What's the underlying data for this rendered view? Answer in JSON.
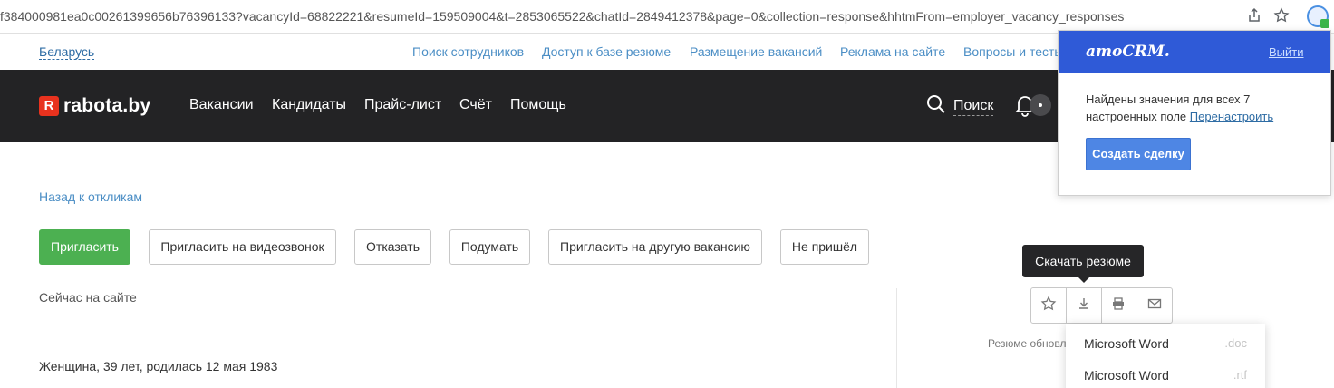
{
  "browser": {
    "url": "f384000981ea0c00261399656b76396133?vacancyId=68822221&resumeId=159509004&t=2853065522&chatId=2849412378&page=0&collection=response&hhtmFrom=employer_vacancy_responses",
    "share_icon": "share-icon",
    "bookmark_icon": "star-icon",
    "extension_icon": "amocrm-extension-icon"
  },
  "toplinks": {
    "region": "Беларусь",
    "items": [
      "Поиск сотрудников",
      "Доступ к базе резюме",
      "Размещение вакансий",
      "Реклама на сайте",
      "Вопросы и тесты"
    ]
  },
  "nav": {
    "logo_letter": "R",
    "logo_text": "rabota.by",
    "items": [
      "Вакансии",
      "Кандидаты",
      "Прайс-лист",
      "Счёт",
      "Помощь"
    ],
    "search_label": "Поиск"
  },
  "content": {
    "back_link": "Назад к откликам",
    "buttons": [
      "Пригласить",
      "Пригласить на видеозвонок",
      "Отказать",
      "Подумать",
      "Пригласить на другую вакансию",
      "Не пришёл"
    ],
    "online_status": "Сейчас на сайте",
    "bio": "Женщина, 39 лет, родилась 12 мая 1983",
    "updated": "Резюме обновл"
  },
  "tooltip": {
    "text": "Скачать резюме"
  },
  "dropdown": {
    "items": [
      {
        "label": "Microsoft Word",
        "ext": ".doc"
      },
      {
        "label": "Microsoft Word",
        "ext": ".rtf"
      }
    ]
  },
  "amocrm": {
    "logo": "amoCRM.",
    "exit": "Выйти",
    "message": "Найдены значения для всех 7 настроенных поле",
    "reconfigure": "Перенастроить",
    "create_button": "Создать сделку"
  },
  "colors": {
    "primary_green": "#4cb051",
    "nav_dark": "#232325",
    "link_blue": "#4b8ec5",
    "amo_blue": "#2f5ad7"
  }
}
